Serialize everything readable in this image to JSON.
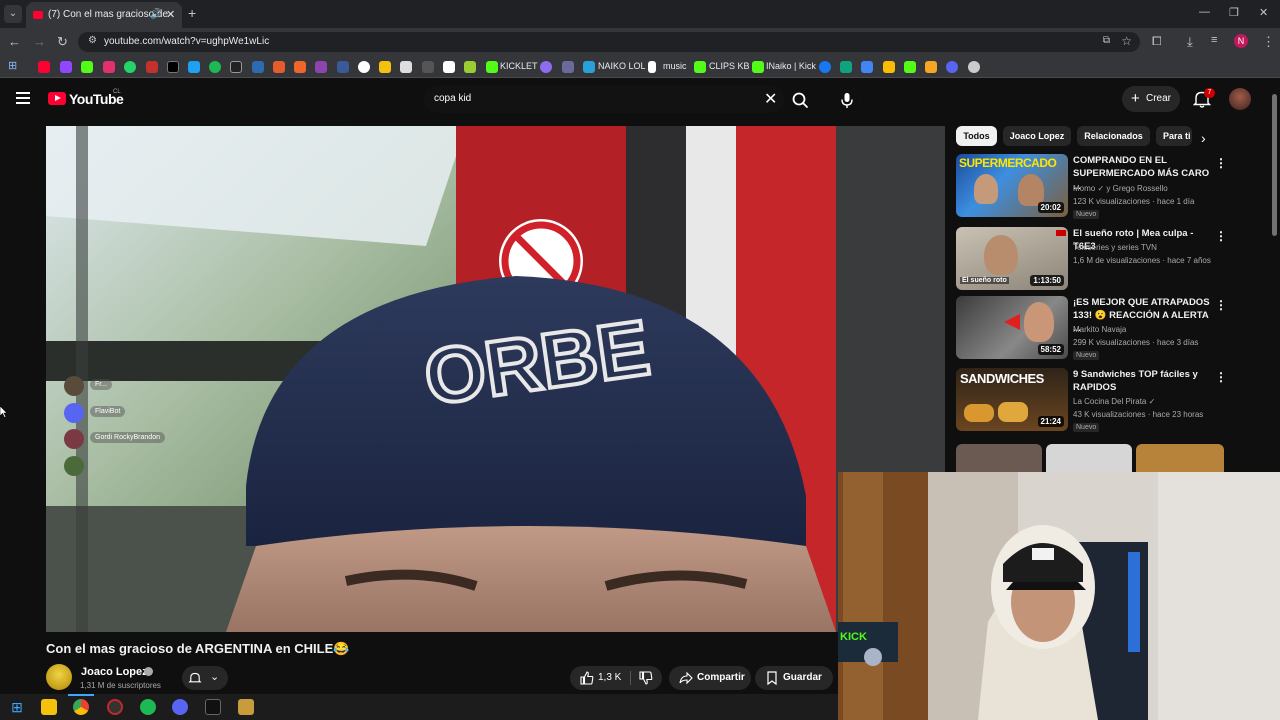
{
  "browser": {
    "tab_title": "(7) Con el mas gracioso de",
    "url": "youtube.com/watch?v=ughpWe1wLic",
    "profile_initial": "N",
    "bookmarks": [
      {
        "label": "KICKLET"
      },
      {
        "label": "NAIKO LOL"
      },
      {
        "label": "music"
      },
      {
        "label": "CLIPS KB"
      },
      {
        "label": "INaiko | Kick"
      }
    ]
  },
  "youtube": {
    "logo_text": "YouTube",
    "country": "CL",
    "search_value": "copa kid",
    "create_label": "Crear",
    "notification_count": "7"
  },
  "video": {
    "title": "Con el mas gracioso de ARGENTINA en CHILE😂",
    "channel": "Joaco Lopez",
    "subscribers": "1,31 M de suscriptores",
    "likes": "1,3 K",
    "share_label": "Compartir",
    "save_label": "Guardar",
    "overlay_users": [
      {
        "name": "Fr...",
        "color": "#5a4a3a"
      },
      {
        "name": "FlaviBot",
        "color": "#5865f2"
      },
      {
        "name": "Gordi RockyBrandon",
        "color": "#7a3a44"
      },
      {
        "name": "",
        "color": "#4a6a3a"
      }
    ]
  },
  "chips": [
    {
      "label": "Todos",
      "active": true
    },
    {
      "label": "Joaco Lopez",
      "active": false
    },
    {
      "label": "Relacionados",
      "active": false
    },
    {
      "label": "Para ti",
      "active": false
    }
  ],
  "recommendations": [
    {
      "title": "COMPRANDO EN EL SUPERMERCADO MÁS CARO ...",
      "channel": "Momo ✓ y Grego Rossello",
      "views": "123 K visualizaciones · hace 1 día",
      "badge": "Nuevo",
      "duration": "20:02",
      "thumb_text": "SUPERMERCADO"
    },
    {
      "title": "El sueño roto | Mea culpa - T6E3",
      "channel": "Teleseries y series TVN",
      "views": "1,6 M de visualizaciones · hace 7 años",
      "badge": "",
      "duration": "1:13:50",
      "thumb_text": "El sueño roto"
    },
    {
      "title": "¡ES MEJOR QUE ATRAPADOS 133! 😮 REACCIÓN A ALERTA ...",
      "channel": "Markito Navaja",
      "views": "299 K visualizaciones · hace 3 días",
      "badge": "Nuevo",
      "duration": "58:52",
      "thumb_text": ""
    },
    {
      "title": "9 Sandwiches TOP fáciles y RAPIDOS",
      "channel": "La Cocina Del Pirata ✓",
      "views": "43 K visualizaciones · hace 23 horas",
      "badge": "Nuevo",
      "duration": "21:24",
      "thumb_text": "SANDWICHES"
    }
  ],
  "colors": {
    "youtube_red": "#ff0033",
    "background": "#0f0f0f",
    "chip_bg": "#272727"
  }
}
